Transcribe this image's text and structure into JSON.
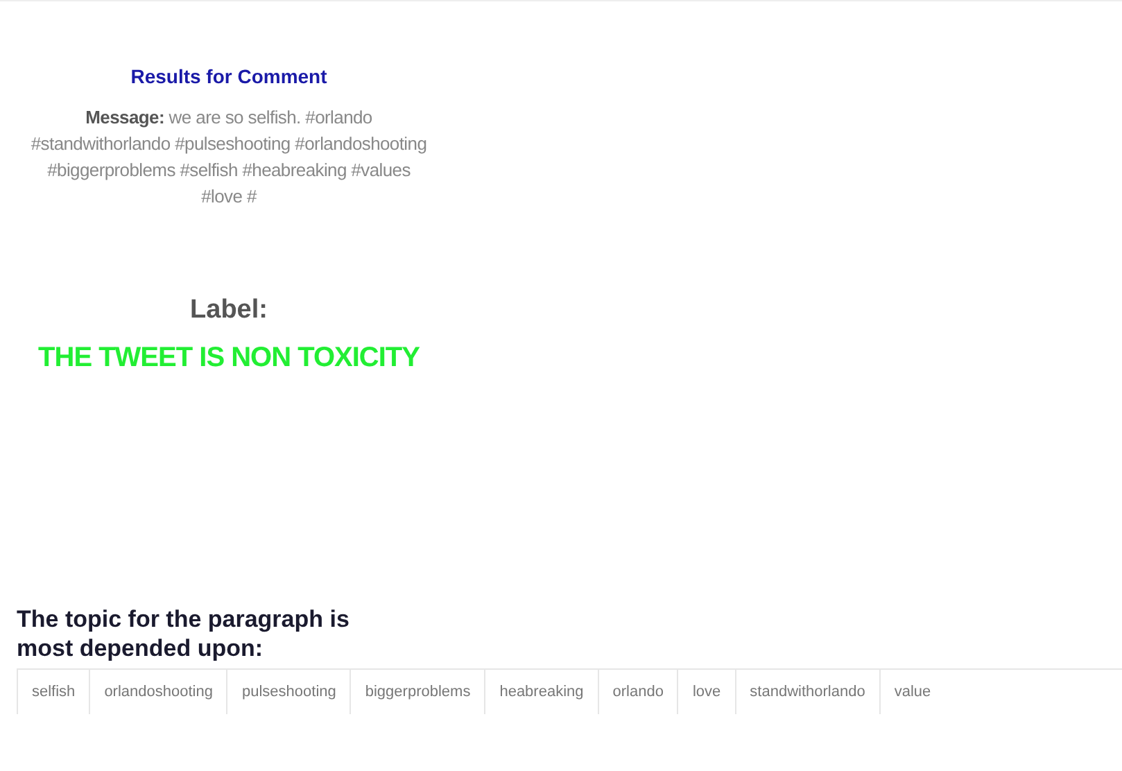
{
  "results_title": "Results for Comment",
  "message": {
    "label": "Message:",
    "text": "we are so selfish. #orlando #standwithorlando #pulseshooting #orlandoshooting #biggerproblems #selfish #heabreaking #values #love #"
  },
  "label_heading": "Label:",
  "label_result": "THE TWEET IS NON TOXICITY",
  "topic_heading": "The topic for the paragraph is most depended upon:",
  "topics": [
    "selfish",
    "orlandoshooting",
    "pulseshooting",
    "biggerproblems",
    "heabreaking",
    "orlando",
    "love",
    "standwithorlando",
    "value"
  ]
}
